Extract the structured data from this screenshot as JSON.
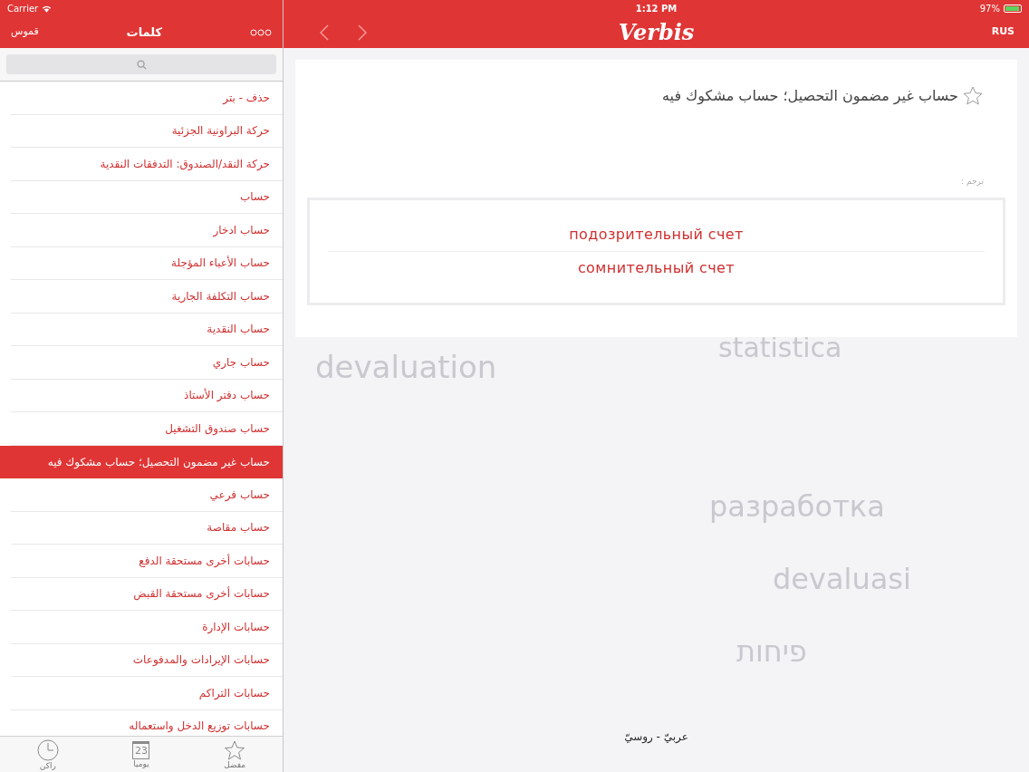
{
  "status_bar": {
    "carrier": "Carrier",
    "time": "1:12 PM",
    "battery": "97%"
  },
  "left_nav": {
    "back": "قموس",
    "title": "كلمات"
  },
  "words": [
    {
      "text": "حذف - بتر",
      "selected": false
    },
    {
      "text": "حركة البراونية الجزئية",
      "selected": false
    },
    {
      "text": "حركة النقد/الصندوق: التدفقات النقدية",
      "selected": false
    },
    {
      "text": "حساب",
      "selected": false
    },
    {
      "text": "حساب ادخار",
      "selected": false
    },
    {
      "text": "حساب الأعباء المؤجلة",
      "selected": false
    },
    {
      "text": "حساب التكلفة الجارية",
      "selected": false
    },
    {
      "text": "حساب النقدية",
      "selected": false
    },
    {
      "text": "حساب جاري",
      "selected": false
    },
    {
      "text": "حساب دفتر الأستاذ",
      "selected": false
    },
    {
      "text": "حساب صندوق التشغيل",
      "selected": false
    },
    {
      "text": "حساب غير مضمون التحصيل؛ حساب مشكوك فيه",
      "selected": true
    },
    {
      "text": "حساب فرعي",
      "selected": false
    },
    {
      "text": "حساب مقاصة",
      "selected": false
    },
    {
      "text": "حسابات أخرى مستحقة الدفع",
      "selected": false
    },
    {
      "text": "حسابات أخرى مستحقة القبض",
      "selected": false
    },
    {
      "text": "حسابات الإدارة",
      "selected": false
    },
    {
      "text": "حسابات الإيرادات والمدفوعات",
      "selected": false
    },
    {
      "text": "حسابات التراكم",
      "selected": false
    },
    {
      "text": "حسابات توزيع الدخل واستعماله",
      "selected": false
    }
  ],
  "tab_bar": [
    {
      "kind": "star",
      "label": "مفضل"
    },
    {
      "kind": "calendar",
      "label": "يوميا",
      "icon_text": "23"
    },
    {
      "kind": "clock",
      "label": "راكن"
    }
  ],
  "right_nav": {
    "logo": "Verbis",
    "language": "RUS"
  },
  "entry": {
    "term": "حساب غير مضمون التحصيل؛ حساب مشكوك فيه",
    "favorite": false,
    "translate_label": "ترجم :",
    "translations": [
      "подозрительный счет",
      "сомнительный счет"
    ]
  },
  "background_words": [
    "statistica",
    "devaluation",
    "разработка",
    "devaluasi",
    "פיחות"
  ],
  "direction": "عربيّ - روسيّ"
}
